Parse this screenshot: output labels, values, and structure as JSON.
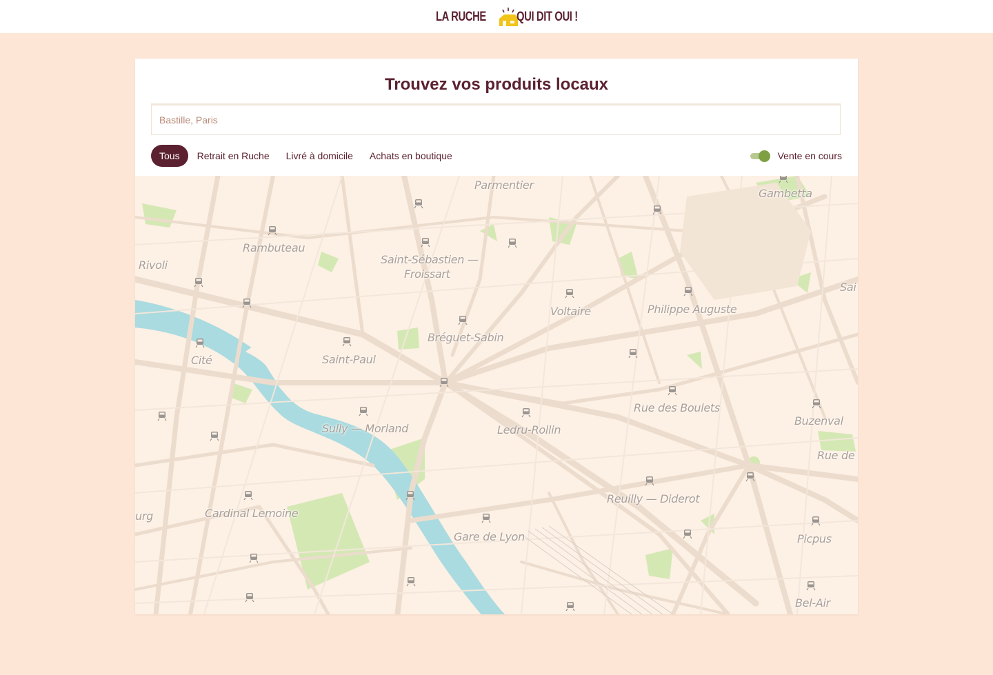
{
  "header": {
    "logo_left": "LA RUCHE",
    "logo_right": "QUI DIT OUI !",
    "logo_icon": "beehive-house-icon"
  },
  "main": {
    "title": "Trouvez vos produits locaux",
    "search": {
      "placeholder": "Bastille, Paris",
      "value": ""
    },
    "filters": [
      {
        "label": "Tous",
        "active": true
      },
      {
        "label": "Retrait en Ruche",
        "active": false
      },
      {
        "label": "Livré à domicile",
        "active": false
      },
      {
        "label": "Achats en boutique",
        "active": false
      }
    ],
    "toggle": {
      "label": "Vente en cours",
      "on": true
    }
  },
  "map": {
    "labels": [
      "Parmentier",
      "Gambetta",
      "Rambuteau",
      "Rivoli",
      "Saint-Sébastien —",
      "Froissart",
      "Voltaire",
      "Philippe Auguste",
      "Sai",
      "Bréguet-Sabin",
      "Cité",
      "Saint-Paul",
      "Rue des Boulets",
      "Buzenval",
      "Sully — Morland",
      "Ledru-Rollin",
      "Rue de",
      "Reuilly — Diderot",
      "urg",
      "Cardinal Lemoine",
      "Gare de Lyon",
      "Picpus",
      "Bel-Air"
    ]
  },
  "colors": {
    "brand": "#5b2130",
    "page_bg": "#fde6d6",
    "toggle_on": "#7ea043",
    "logo_yellow": "#f2c318",
    "map_bg": "#fdf0e4",
    "water": "#a9dbe0",
    "park": "#cfe6ae"
  }
}
